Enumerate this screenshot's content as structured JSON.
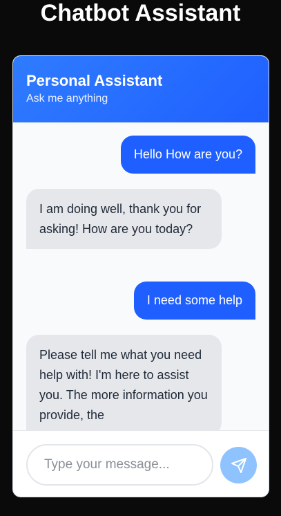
{
  "page": {
    "title": "Chatbot Assistant"
  },
  "chat": {
    "header": {
      "title": "Personal Assistant",
      "subtitle": "Ask me anything"
    },
    "messages": [
      {
        "role": "user",
        "text": "Hello How are you?"
      },
      {
        "role": "bot",
        "text": "I am doing well, thank you for asking! How are you today?"
      },
      {
        "role": "user",
        "text": "I need some help"
      },
      {
        "role": "bot",
        "text": "Please tell me what you need help with! I'm here to assist you. The more information you provide, the"
      }
    ],
    "input": {
      "placeholder": "Type your message...",
      "value": ""
    },
    "send": {
      "icon": "send-icon"
    }
  },
  "colors": {
    "accent": "#1f5fff",
    "bot_bubble": "#e5e7eb",
    "send_button": "#8fc3ff",
    "background": "#0a0a0a"
  }
}
